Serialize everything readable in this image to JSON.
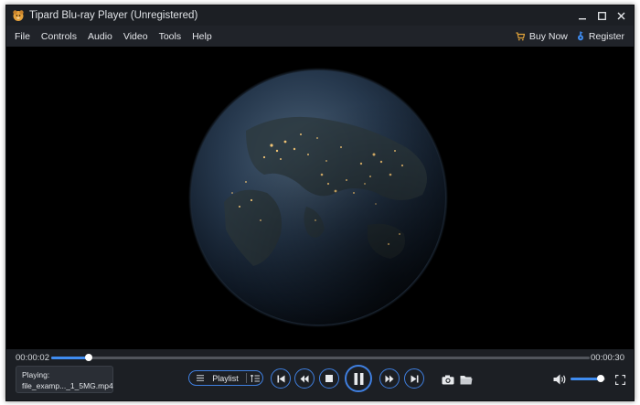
{
  "window": {
    "title": "Tipard Blu-ray Player (Unregistered)"
  },
  "menu": {
    "items": [
      "File",
      "Controls",
      "Audio",
      "Video",
      "Tools",
      "Help"
    ],
    "buy_now": "Buy Now",
    "register": "Register"
  },
  "playback": {
    "current_time": "00:00:02",
    "total_time": "00:00:30",
    "progress": 0.069,
    "volume": 0.88
  },
  "now_playing": {
    "label": "Playing:",
    "file": "file_examp..._1_5MG.mp4"
  },
  "controls": {
    "playlist_label": "Playlist"
  },
  "colors": {
    "accent": "#3f8cf0",
    "background": "#1c1f24",
    "buy_now_icon": "#e0a23a"
  },
  "icons": {
    "logo": "app-logo-icon",
    "minimize": "minimize-icon",
    "maximize": "maximize-icon",
    "close": "close-icon",
    "buy_now": "cart-icon",
    "register": "key-icon",
    "playlist": "list-icon",
    "playlist_sort": "sort-icon",
    "prev": "skip-previous-icon",
    "rewind": "rewind-icon",
    "stop": "stop-icon",
    "pause": "pause-icon",
    "forward": "fast-forward-icon",
    "next": "skip-next-icon",
    "snapshot": "camera-icon",
    "open": "folder-icon",
    "volume": "volume-icon",
    "fullscreen": "fullscreen-icon"
  }
}
